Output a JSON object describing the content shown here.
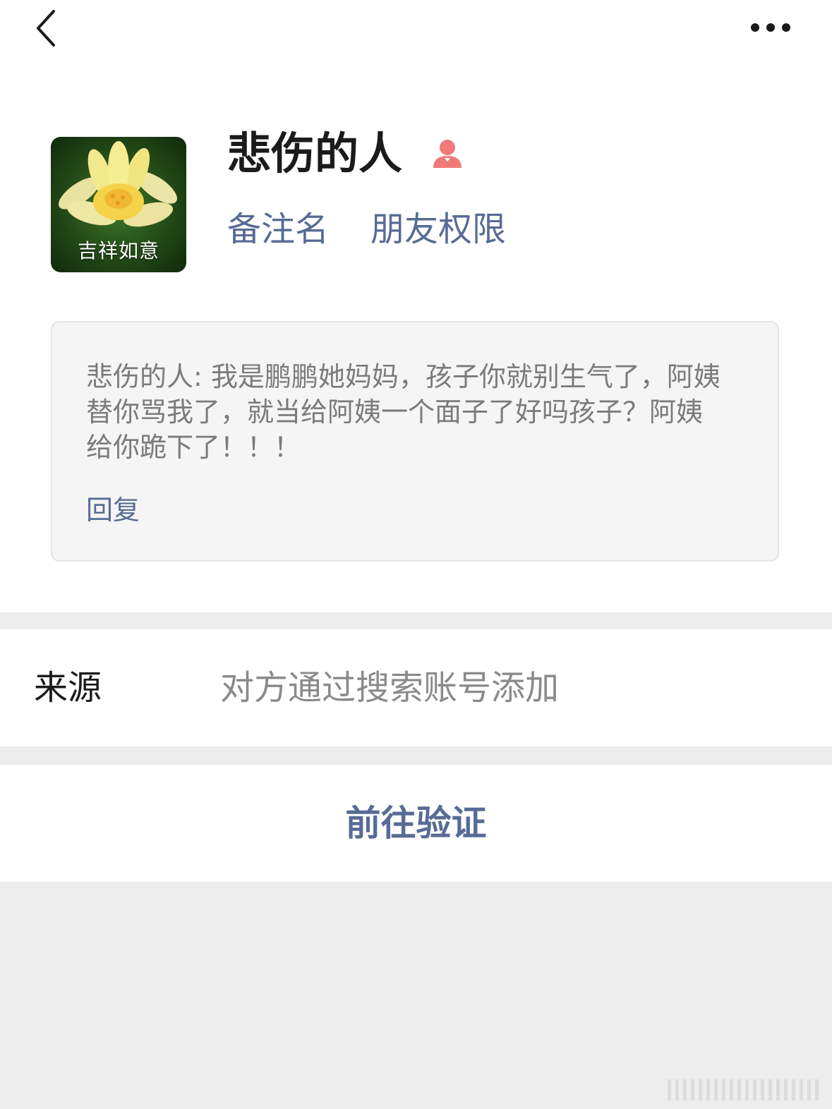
{
  "header": {
    "back_icon": "chevron-left-icon",
    "more_icon": "ellipsis-icon"
  },
  "profile": {
    "avatar_caption": "吉祥如意",
    "nickname": "悲伤的人",
    "gender_icon": "female-person-icon",
    "gender_color": "#f07a7a",
    "remark_label": "备注名",
    "permission_label": "朋友权限"
  },
  "greeting": {
    "message": "悲伤的人: 我是鹏鹏她妈妈，孩子你就别生气了，阿姨替你骂我了，就当给阿姨一个面子了好吗孩子？阿姨给你跪下了！！！",
    "reply_label": "回复"
  },
  "source": {
    "label": "来源",
    "value": "对方通过搜索账号添加"
  },
  "action": {
    "verify_label": "前往验证"
  },
  "colors": {
    "link": "#576b95",
    "background": "#ededed",
    "card": "#f5f5f5"
  }
}
